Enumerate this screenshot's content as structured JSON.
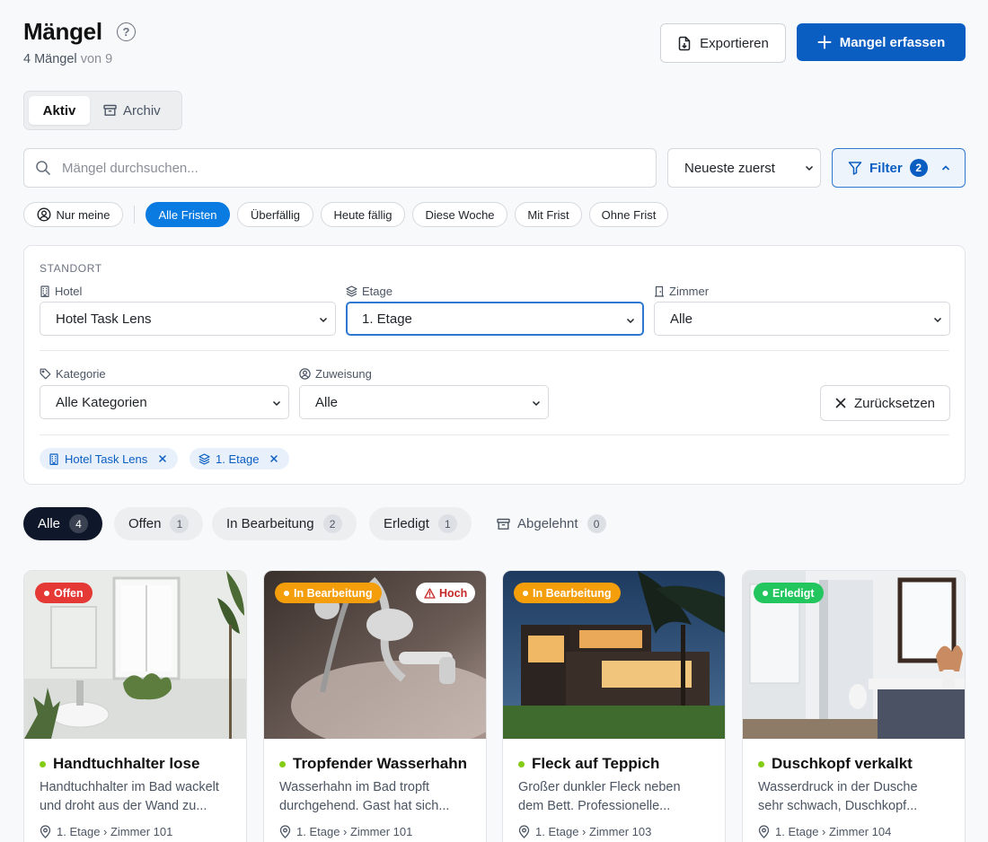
{
  "header": {
    "title": "Mängel",
    "count_text": "4 Mängel",
    "of_text": "von 9",
    "export_label": "Exportieren",
    "create_label": "Mangel erfassen"
  },
  "view_toggle": {
    "active": "Aktiv",
    "archive": "Archiv"
  },
  "search": {
    "placeholder": "Mängel durchsuchen...",
    "value": ""
  },
  "sort": {
    "selected": "Neueste zuerst"
  },
  "filter_button": {
    "label": "Filter",
    "count": "2"
  },
  "quick_filters": {
    "mine": "Nur meine",
    "items": [
      "Alle Fristen",
      "Überfällig",
      "Heute fällig",
      "Diese Woche",
      "Mit Frist",
      "Ohne Frist"
    ],
    "active_index": 0
  },
  "filter_panel": {
    "section": "STANDORT",
    "hotel": {
      "label": "Hotel",
      "value": "Hotel Task Lens"
    },
    "floor": {
      "label": "Etage",
      "value": "1. Etage"
    },
    "room": {
      "label": "Zimmer",
      "value": "Alle"
    },
    "category": {
      "label": "Kategorie",
      "value": "Alle Kategorien"
    },
    "assignment": {
      "label": "Zuweisung",
      "value": "Alle"
    },
    "reset_label": "Zurücksetzen",
    "tags": [
      "Hotel Task Lens",
      "1. Etage"
    ]
  },
  "status_tabs": [
    {
      "label": "Alle",
      "count": "4"
    },
    {
      "label": "Offen",
      "count": "1"
    },
    {
      "label": "In Bearbeitung",
      "count": "2"
    },
    {
      "label": "Erledigt",
      "count": "1"
    },
    {
      "label": "Abgelehnt",
      "count": "0"
    }
  ],
  "cards": [
    {
      "status": "Offen",
      "status_color": "#e53935",
      "priority": "",
      "title": "Handtuchhalter lose",
      "desc1": "Handtuchhalter im Bad wackelt",
      "desc2": "und droht aus der Wand zu...",
      "location": "1. Etage › Zimmer 101"
    },
    {
      "status": "In Bearbeitung",
      "status_color": "#f59e0b",
      "priority": "Hoch",
      "title": "Tropfender Wasserhahn",
      "desc1": "Wasserhahn im Bad tropft",
      "desc2": "durchgehend. Gast hat sich...",
      "location": "1. Etage › Zimmer 101"
    },
    {
      "status": "In Bearbeitung",
      "status_color": "#f59e0b",
      "priority": "",
      "title": "Fleck auf Teppich",
      "desc1": "Großer dunkler Fleck neben",
      "desc2": "dem Bett. Professionelle...",
      "location": "1. Etage › Zimmer 103"
    },
    {
      "status": "Erledigt",
      "status_color": "#22c55e",
      "priority": "",
      "title": "Duschkopf verkalkt",
      "desc1": "Wasserdruck in der Dusche",
      "desc2": "sehr schwach, Duschkopf...",
      "location": "1. Etage › Zimmer 104"
    }
  ]
}
